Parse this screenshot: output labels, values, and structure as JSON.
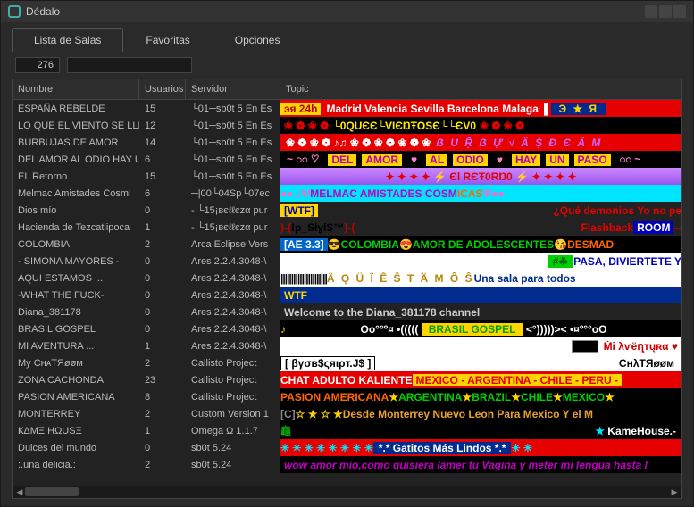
{
  "window": {
    "title": "Dédalo"
  },
  "tabs": {
    "salas": "Lista de Salas",
    "favoritas": "Favoritas",
    "opciones": "Opciones"
  },
  "controls": {
    "count": "276",
    "search": ""
  },
  "columns": {
    "nombre": "Nombre",
    "usuarios": "Usuarios",
    "servidor": "Servidor",
    "topic": "Topic"
  },
  "rows": [
    {
      "nombre": "ESPAÑA REBELDE",
      "usuarios": "15",
      "servidor": "└01─sb0t 5 En Es",
      "topic_key": "espana"
    },
    {
      "nombre": "LO QUE EL VIENTO SE LLE",
      "usuarios": "12",
      "servidor": "└01─sb0t 5 En Es",
      "topic_key": "viento"
    },
    {
      "nombre": "BURBUJAS DE AMOR",
      "usuarios": "14",
      "servidor": "└01─sb0t 5 En Es",
      "topic_key": "burbujas"
    },
    {
      "nombre": "DEL AMOR AL ODIO HAY U",
      "usuarios": "6",
      "servidor": "└01─sb0t 5 En Es",
      "topic_key": "amor_odio"
    },
    {
      "nombre": "EL Retorno",
      "usuarios": "15",
      "servidor": "└01─sb0t 5 En Es",
      "topic_key": "retorno"
    },
    {
      "nombre": "Melmac  Amistades Cosmi",
      "usuarios": "6",
      "servidor": "─|00└04Sp└07ec",
      "topic_key": "melmac"
    },
    {
      "nombre": "Dios mío",
      "usuarios": "0",
      "servidor": "- └15¡вєℓℓєzα pur",
      "topic_key": "dios"
    },
    {
      "nombre": "Hacienda de Tezcatlipoca",
      "usuarios": "1",
      "servidor": "- └15¡вєℓℓєzα pur",
      "topic_key": "hacienda"
    },
    {
      "nombre": "COLOMBIA",
      "usuarios": "2",
      "servidor": "Arca Eclipse Vers",
      "topic_key": "colombia"
    },
    {
      "nombre": "- SIMONA MAYORES -",
      "usuarios": "0",
      "servidor": "Ares 2.2.4.3048-\\",
      "topic_key": "simona"
    },
    {
      "nombre": "AQUI ESTAMOS ...",
      "usuarios": "0",
      "servidor": "Ares 2.2.4.3048-\\",
      "topic_key": "aqui"
    },
    {
      "nombre": "-WHAT THE FUCK-",
      "usuarios": "0",
      "servidor": "Ares 2.2.4.3048-\\",
      "topic_key": "wtf"
    },
    {
      "nombre": "Diana_381178",
      "usuarios": "0",
      "servidor": "Ares 2.2.4.3048-\\",
      "topic_key": "diana"
    },
    {
      "nombre": "BRASIL GOSPEL",
      "usuarios": "0",
      "servidor": "Ares 2.2.4.3048-\\",
      "topic_key": "brasil"
    },
    {
      "nombre": "MI AVENTURA ...",
      "usuarios": "1",
      "servidor": "Ares 2.2.4.3048-\\",
      "topic_key": "aventura"
    },
    {
      "nombre": "My CʜᴀTЯøøм",
      "usuarios": "2",
      "servidor": "Callisto Project",
      "topic_key": "chatroom"
    },
    {
      "nombre": "ZONA CACHONDA",
      "usuarios": "23",
      "servidor": "Callisto Project",
      "topic_key": "cachonda"
    },
    {
      "nombre": "PASION AMERICANA",
      "usuarios": "8",
      "servidor": "Callisto Project",
      "topic_key": "pasion"
    },
    {
      "nombre": "MONTERREY",
      "usuarios": "2",
      "servidor": "Custom Version 1",
      "topic_key": "monterrey"
    },
    {
      "nombre": "ҜΔMΞ HΩUSΞ",
      "usuarios": "1",
      "servidor": "Omega Ω 1.1.7",
      "topic_key": "kame"
    },
    {
      "nombre": "Dulces del mundo",
      "usuarios": "0",
      "servidor": "sb0t 5.24",
      "topic_key": "dulces"
    },
    {
      "nombre": ":.una delicia.:",
      "usuarios": "2",
      "servidor": "sb0t 5.24",
      "topic_key": "delicia"
    }
  ],
  "topics": {
    "espana": {
      "seg1": "эя 24h",
      "seg2": "Madrid Valencia Sevilla Barcelona  Malaga",
      "seg3": "Э ★ Я"
    },
    "viento": {
      "lo": "└0",
      "que": "QUЄ",
      "el": "Є└",
      "viento": "VIЄŊŦO",
      "se": "SЄ",
      "llevo": "└└ЄV0"
    },
    "burbujas": {
      "dots": "❀ ❁ ❀ ❁ ♪♫ ❀ ❁ ❀ ❁ ❀ ❁ ❀",
      "txt": "ẞ U Ṝ ẞ Ự √ Ä Ṩ  Ð Є  Ä M"
    },
    "amor_odio": {
      "pre": "~ ೦೦ ♡",
      "del": "DEL",
      "amor": "AMOR",
      "heart1": "♥",
      "al": "AL",
      "odio": "ODIO",
      "heart2": "♥",
      "hay": "HAY",
      "un": "UN",
      "paso": "PASO",
      "post": "೦೦ ~"
    },
    "retorno": {
      "txt": "✦ ✦ ✦ ✦  ⚡ Єl RЄŦ0RŊ0 ⚡  ✦ ✦ ✦ ✦"
    },
    "melmac": {
      "pre": "●●♫Ψ",
      "melmac": "MELMAC AMISTADES COSM",
      "icas": "ICAS",
      "post": "Ψ●●"
    },
    "dios": {
      "wtf": "[WTF]",
      "txt": "¿Qué demonios Yo no pe"
    },
    "hacienda": {
      "h": ")-(",
      "styls": "!p_SłɣlS™",
      "h2": ")-(",
      "flash": "Flashback",
      "room": "ROOM"
    },
    "colombia": {
      "ae": "[AE 3.3]",
      "col": "COLOMBIA",
      "amor": "AMOR DE ADOLESCENTES",
      "desmad": "DESMAD"
    },
    "simona": {
      "hash": "#☘",
      "txt": "PASA, DIVIERTETE Y"
    },
    "aqui": {
      "bars": "|||||||||||||||||||||| ",
      "gold": "Ä Ǫ Ü Ï  Ê Ŝ Ŧ Ä M Ô Ŝ ",
      "txt": "Una sala para todos"
    },
    "wtf": {
      "txt": "WTF"
    },
    "diana": {
      "txt": "Welcome to the Diana_381178  channel"
    },
    "brasil": {
      "note": "♪",
      "oo": "Oo°°º¤ •(((((  ",
      "gospel": "BRASIL GOSPEL",
      "close": "   <°)))))>< •¤º°°oO"
    },
    "aventura": {
      "txt": "Ṁi  λѵёղтųʀα ♥"
    },
    "chatroom": {
      "js": "[ βγσв$ςяιρт.J$ ]",
      "cht": "CʜλTЯøøм"
    },
    "cachonda": {
      "kaliente": " CHAT ADULTO KALIENTE ",
      "countries": " MEXICO - ARGENTINA - CHILE - PERU - "
    },
    "pasion": {
      "txt": "PASION AMERICANA",
      "seq": "★ARGENTINA★BRAZIL★CHILE★MEXICO★"
    },
    "monterrey": {
      "c": "[C]",
      "stars": " ☆ ★ ☆ ★ ",
      "txt": "Desde Monterrey Nuevo Leon Para Mexico Y el M"
    },
    "kame": {
      "turtle": "龜",
      "right": "★ KameHouse.-"
    },
    "dulces": {
      "pattern": "✳ ✳ ✳ ✳ ✳ ✳ ✳ ✳ ",
      "txt": "*.* Gatitos Más Lindos *.*"
    },
    "delicia": {
      "txt": "wow amor mio,como quisiera lamer tu Vagina y meter mi lengua hasta l"
    }
  }
}
